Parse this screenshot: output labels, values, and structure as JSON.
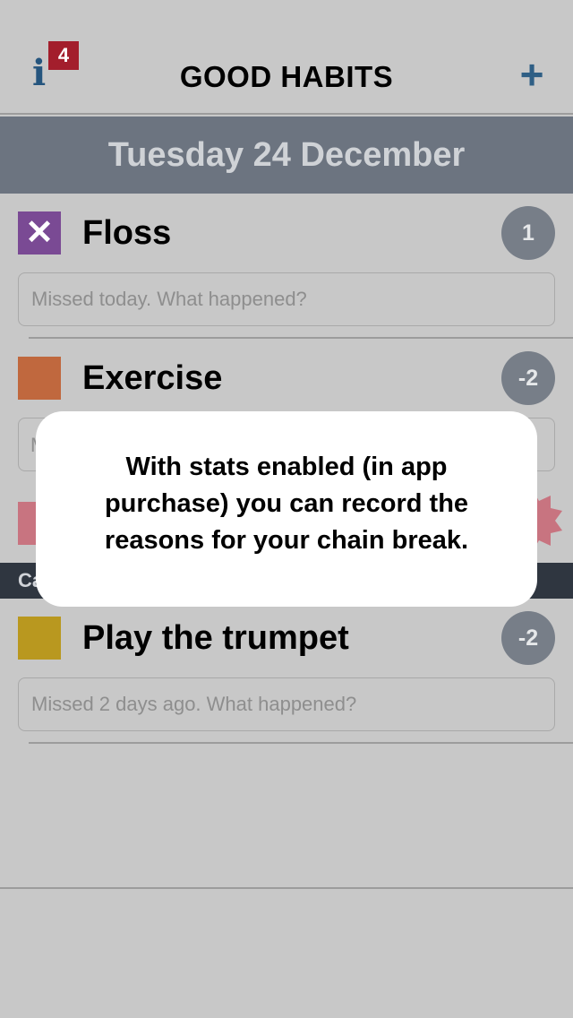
{
  "nav": {
    "info_glyph": "i",
    "badge_count": "4",
    "title": "GOOD HABITS",
    "add_glyph": "+"
  },
  "date_header": "Tuesday 24 December",
  "habits": [
    {
      "name": "Floss",
      "color": "#7a4a94",
      "mark": "✕",
      "count": "1",
      "reason_placeholder": "Missed today. What happened?"
    },
    {
      "name": "Exercise",
      "color": "#c0683e",
      "count": "-2",
      "reason_placeholder": "M"
    },
    {
      "name": "Play the trumpet",
      "color": "#b9981f",
      "count": "-2",
      "reason_placeholder": "Missed 2 days ago. What happened?"
    }
  ],
  "hidden_section": {
    "label": "Ca",
    "swatch_color": "#c87480",
    "badge_color": "#c87480"
  },
  "popup": {
    "message": "With stats enabled (in app purchase) you can record the reasons for your chain break."
  },
  "colors": {
    "background": "#c8c8c8",
    "nav_accent": "#2f5f85",
    "badge_red": "#a31e2c",
    "date_bar": "#6c7480",
    "count_circle": "#777e88",
    "section_bar": "#2f3640"
  }
}
